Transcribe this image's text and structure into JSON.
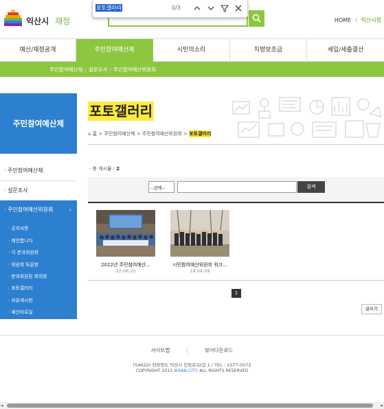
{
  "header": {
    "logo_city": "익산시",
    "logo_sub": "재정",
    "home": "HOME",
    "site_link": "익산시청"
  },
  "findbar": {
    "query": "포토갤러리",
    "count": "0/3"
  },
  "gnb": [
    "예산/재정공개",
    "주민참여예산제",
    "시민의소리",
    "지방보조금",
    "세입/세출결산"
  ],
  "subnav": [
    "주민참여예산제",
    "설문조사",
    "주민참여예산위원회"
  ],
  "lnb": {
    "title": "주민참여예산제",
    "items": [
      "주민참여예산제",
      "설문조사",
      "주민참여예산위원회"
    ],
    "sub": [
      "공지사항",
      "제안합니다",
      "각 분과위원회",
      "위원회 토론방",
      "분과위원장 회의방",
      "포토갤러리",
      "자유게시판",
      "예산자료실"
    ]
  },
  "content": {
    "title": "포토갤러리",
    "breadcrumb": [
      "홈",
      "주민참여예산제",
      "주민참여예산위원회",
      "포토갤러리"
    ],
    "total_label": "· 총 게시물 :",
    "total_count": "2",
    "select_value": "--선택--",
    "search_button": "검색",
    "cards": [
      {
        "title": "2022년 주민참여예산...",
        "date": "22.06.20"
      },
      {
        "title": "시민참여예산위원회 워크...",
        "date": "18.04.09"
      }
    ],
    "page": "1",
    "write_button": "글쓰기"
  },
  "footer": {
    "sitemap": "사이트맵",
    "viewer": "뷰어다운로드",
    "address": "(54622) 전라북도 익산시 인북로32길 1 / TEL : 1577-0072",
    "copy_prefix": "COPYRIGHT 2015 ",
    "copy_brand": "IKSAN CITY",
    "copy_suffix": ". ALL RIGHTS RESERVED"
  },
  "colors": {
    "green": "#8dc63f",
    "blue": "#2d7fcf",
    "highlight": "#ffeb3b"
  }
}
